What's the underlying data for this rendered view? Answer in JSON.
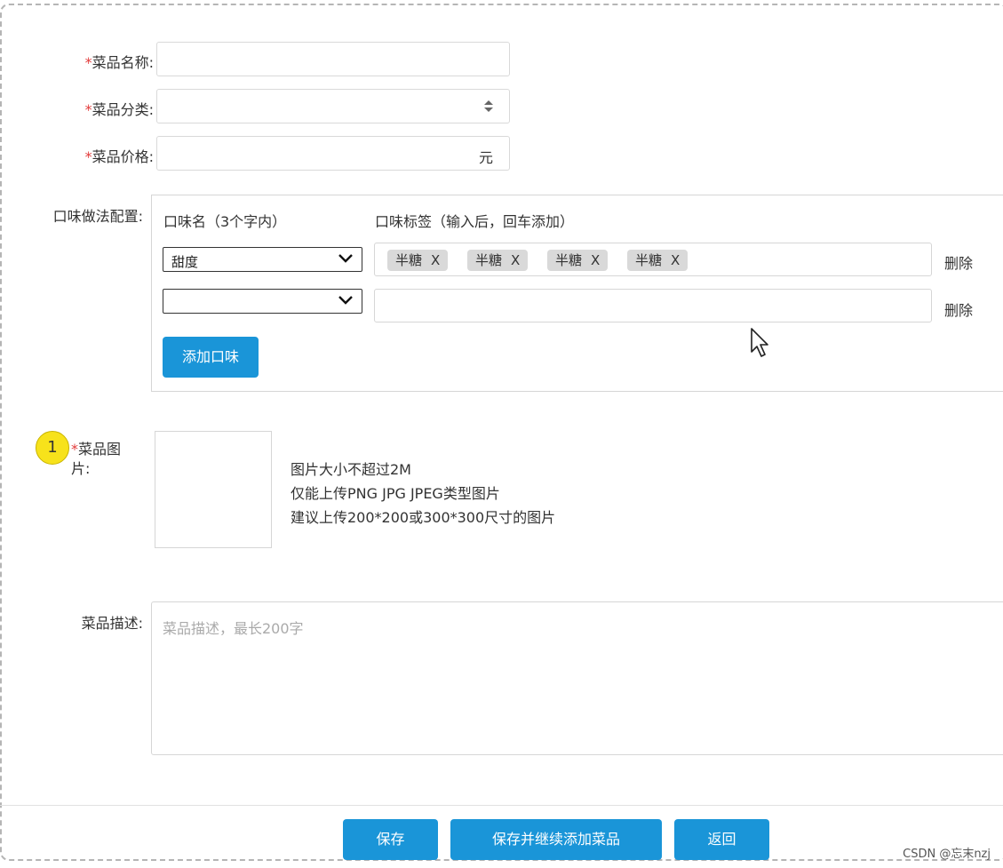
{
  "form": {
    "name_label": "菜品名称:",
    "category_label": "菜品分类:",
    "price_label": "菜品价格:",
    "price_unit": "元",
    "flavor_label": "口味做法配置:",
    "image_label": "菜品图片:",
    "desc_label": "菜品描述:",
    "desc_placeholder": "菜品描述，最长200字",
    "required_mark": "*"
  },
  "flavor": {
    "name_col": "口味名（3个字内）",
    "tag_col": "口味标签（输入后，回车添加）",
    "rows": [
      {
        "name": "甜度",
        "tags": [
          "半糖",
          "半糖",
          "半糖",
          "半糖"
        ],
        "tag_close": "X",
        "delete": "删除"
      },
      {
        "name": "",
        "tags": [],
        "delete": "删除"
      }
    ],
    "add_button": "添加口味"
  },
  "image": {
    "badge": "1",
    "hints": [
      "图片大小不超过2M",
      "仅能上传PNG JPG JPEG类型图片",
      "建议上传200*200或300*300尺寸的图片"
    ]
  },
  "footer": {
    "save": "保存",
    "save_continue": "保存并继续添加菜品",
    "back": "返回"
  },
  "watermark": "CSDN @忘末nzj",
  "colors": {
    "primary": "#1a95d8",
    "required": "#e23b3b",
    "badge": "#f7e21b",
    "tag_bg": "#d9d9d9"
  }
}
